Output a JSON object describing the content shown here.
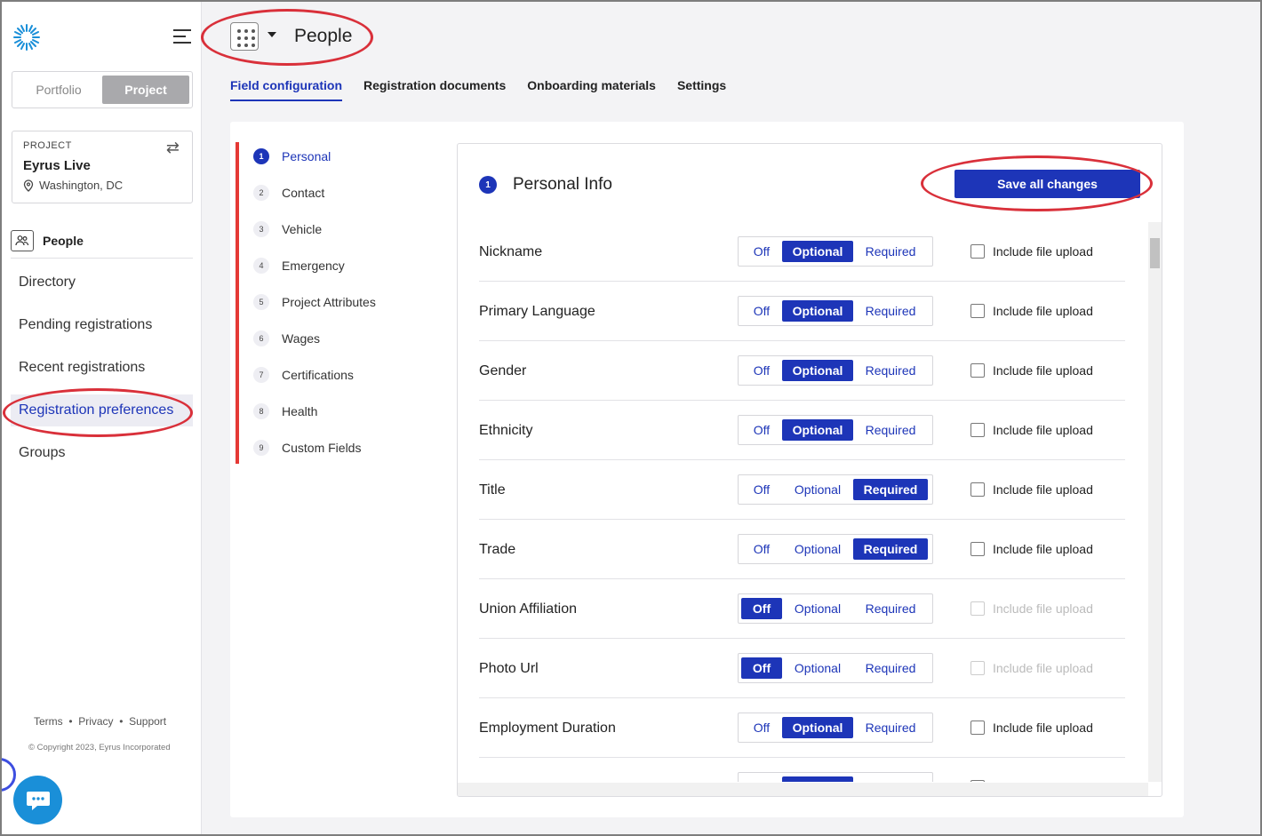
{
  "sidebar": {
    "toggle": {
      "portfolio": "Portfolio",
      "project": "Project"
    },
    "project_card": {
      "label": "PROJECT",
      "name": "Eyrus Live",
      "location": "Washington, DC"
    },
    "section_title": "People",
    "nav": [
      "Directory",
      "Pending registrations",
      "Recent registrations",
      "Registration preferences",
      "Groups"
    ],
    "active_nav": "Registration preferences",
    "footer": {
      "links": [
        "Terms",
        "Privacy",
        "Support"
      ],
      "separator": "•",
      "copyright": "© Copyright 2023, Eyrus Incorporated"
    }
  },
  "header": {
    "title": "People"
  },
  "tabs": [
    "Field configuration",
    "Registration documents",
    "Onboarding materials",
    "Settings"
  ],
  "active_tab": "Field configuration",
  "steps": [
    {
      "num": "1",
      "label": "Personal"
    },
    {
      "num": "2",
      "label": "Contact"
    },
    {
      "num": "3",
      "label": "Vehicle"
    },
    {
      "num": "4",
      "label": "Emergency"
    },
    {
      "num": "5",
      "label": "Project Attributes"
    },
    {
      "num": "6",
      "label": "Wages"
    },
    {
      "num": "7",
      "label": "Certifications"
    },
    {
      "num": "8",
      "label": "Health"
    },
    {
      "num": "9",
      "label": "Custom Fields"
    }
  ],
  "section": {
    "num": "1",
    "title": "Personal Info",
    "save_label": "Save all changes"
  },
  "options": {
    "off": "Off",
    "optional": "Optional",
    "required": "Required",
    "file_upload": "Include file upload"
  },
  "fields": [
    {
      "label": "Nickname",
      "value": "Optional",
      "upload_enabled": true
    },
    {
      "label": "Primary Language",
      "value": "Optional",
      "upload_enabled": true
    },
    {
      "label": "Gender",
      "value": "Optional",
      "upload_enabled": true
    },
    {
      "label": "Ethnicity",
      "value": "Optional",
      "upload_enabled": true
    },
    {
      "label": "Title",
      "value": "Required",
      "upload_enabled": true
    },
    {
      "label": "Trade",
      "value": "Required",
      "upload_enabled": true
    },
    {
      "label": "Union Affiliation",
      "value": "Off",
      "upload_enabled": false
    },
    {
      "label": "Photo Url",
      "value": "Off",
      "upload_enabled": false
    },
    {
      "label": "Employment Duration",
      "value": "Optional",
      "upload_enabled": true
    },
    {
      "label": "",
      "value": "Optional",
      "upload_enabled": true
    }
  ],
  "colors": {
    "brand": "#1d35b8",
    "annotation": "#d9303a",
    "chat": "#1a8fd8"
  }
}
